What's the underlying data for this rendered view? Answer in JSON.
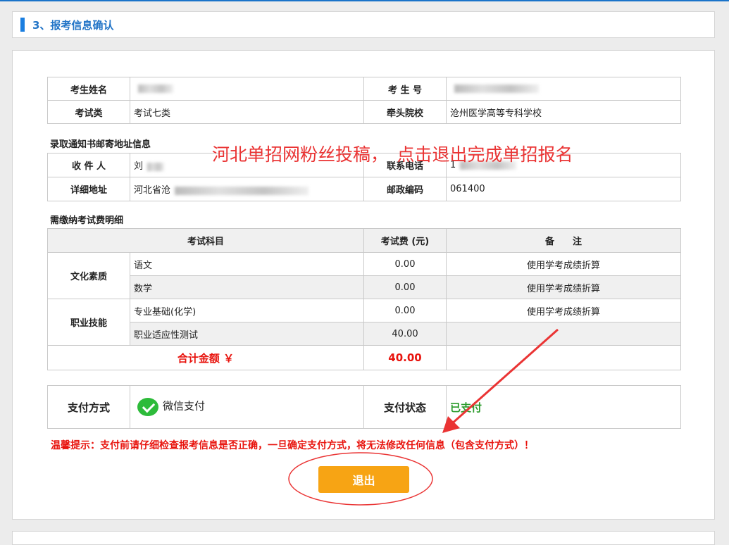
{
  "section": {
    "title": "3、报考信息确认"
  },
  "candidate": {
    "name_label": "考生姓名",
    "name_value": "",
    "id_label": "考 生 号",
    "id_value": "",
    "category_label": "考试类",
    "category_value": "考试七类",
    "school_label": "牵头院校",
    "school_value": "沧州医学高等专科学校"
  },
  "mailing": {
    "heading": "录取通知书邮寄地址信息",
    "recipient_label": "收 件 人",
    "recipient_value": "刘",
    "phone_label": "联系电话",
    "phone_value": "1",
    "address_label": "详细地址",
    "address_value": "河北省沧",
    "postcode_label": "邮政编码",
    "postcode_value": "061400"
  },
  "fees": {
    "heading": "需缴纳考试费明细",
    "col_subject": "考试科目",
    "col_fee": "考试费 (元)",
    "col_note": "备　　注",
    "groups": [
      {
        "name": "文化素质",
        "rows": [
          {
            "subject": "语文",
            "fee": "0.00",
            "note": "使用学考成绩折算"
          },
          {
            "subject": "数学",
            "fee": "0.00",
            "note": "使用学考成绩折算"
          }
        ]
      },
      {
        "name": "职业技能",
        "rows": [
          {
            "subject": "专业基础(化学)",
            "fee": "0.00",
            "note": "使用学考成绩折算"
          },
          {
            "subject": "职业适应性测试",
            "fee": "40.00",
            "note": ""
          }
        ]
      }
    ],
    "total_label": "合计金额 ￥",
    "total_value": "40.00"
  },
  "payment": {
    "method_label": "支付方式",
    "method_value": "微信支付",
    "status_label": "支付状态",
    "status_value": "已支付"
  },
  "tip": "温馨提示：支付前请仔细检查报考信息是否正确，一旦确定支付方式，将无法修改任何信息（包含支付方式）！",
  "exit_button": "退出",
  "watermark": "河北单招网粉丝投稿，　点击退出完成单招报名",
  "colors": {
    "accent": "#1a7ee0",
    "red": "#e8140e",
    "button": "#f7a414",
    "paid": "#2a9a2a"
  }
}
